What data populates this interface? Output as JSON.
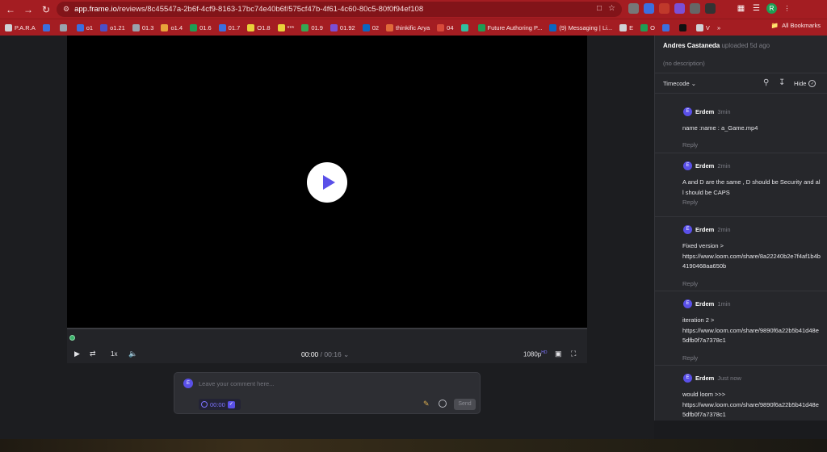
{
  "browser": {
    "url_host": "app.frame.io",
    "url_path": "/reviews/8c45547a-2b6f-4cf9-8163-17bc74e40b6f/575cf47b-4f61-4c60-80c5-80f0f94ef108",
    "profile_initial": "R"
  },
  "bookmarks": [
    {
      "label": "P.A.R.A",
      "color": "#cfd2d6"
    },
    {
      "label": "",
      "color": "#3b6fe0"
    },
    {
      "label": "",
      "color": "#9aa3ad"
    },
    {
      "label": "o1",
      "color": "#3b6fe0"
    },
    {
      "label": "o1.21",
      "color": "#4b4fc7"
    },
    {
      "label": "01.3",
      "color": "#9aa3ad"
    },
    {
      "label": "o1.4",
      "color": "#e8a33a"
    },
    {
      "label": "01.6",
      "color": "#1e9e54"
    },
    {
      "label": "01.7",
      "color": "#3b6fe0"
    },
    {
      "label": "O1.8",
      "color": "#e8d23a"
    },
    {
      "label": "***",
      "color": "#e8d23a"
    },
    {
      "label": "01.9",
      "color": "#34a853"
    },
    {
      "label": "01.92",
      "color": "#7b4fd6"
    },
    {
      "label": "02",
      "color": "#0a66c2"
    },
    {
      "label": "thinkific Arya",
      "color": "#e06a3a"
    },
    {
      "label": "04",
      "color": "#d84a3a"
    },
    {
      "label": "",
      "color": "#2fbfa0"
    },
    {
      "label": "Future Authoring P...",
      "color": "#1e9e54"
    },
    {
      "label": "(9) Messaging | Li...",
      "color": "#0a66c2"
    },
    {
      "label": "E",
      "color": "#cfd2d6"
    },
    {
      "label": "O",
      "color": "#1e9e54"
    },
    {
      "label": "",
      "color": "#3b6fe0"
    },
    {
      "label": "",
      "color": "#111"
    },
    {
      "label": "V",
      "color": "#cfd2d6"
    }
  ],
  "bookmarks_all": "All Bookmarks",
  "player": {
    "time_current": "00:00",
    "time_separator": "/",
    "time_duration": "00:16",
    "speed": "1x",
    "quality": "1080p",
    "quality_badge": "HD"
  },
  "composer": {
    "avatar_initial": "E",
    "placeholder": "Leave your comment here...",
    "timecode": "00:00",
    "send_label": "Send"
  },
  "sidebar": {
    "uploader_name": "Andres Castaneda",
    "uploader_action": "uploaded",
    "uploader_ago": "5d ago",
    "description": "(no description)",
    "timecode_menu": "Timecode",
    "hide_label": "Hide",
    "reply_label": "Reply",
    "comments": [
      {
        "initial": "E",
        "author": "Erdem",
        "time": "3min",
        "body": "name :name : a_Game.mp4"
      },
      {
        "initial": "E",
        "author": "Erdem",
        "time": "2min",
        "body": "A and D are the same , D should be Security and all should be CAPS"
      },
      {
        "initial": "E",
        "author": "Erdem",
        "time": "2min",
        "body": "Fixed version >\nhttps://www.loom.com/share/8a22240b2e7f4af1b4b4190468aa650b"
      },
      {
        "initial": "E",
        "author": "Erdem",
        "time": "1min",
        "body": "iteration 2 >\nhttps://www.loom.com/share/9890f6a22b5b41d48e5dfb0f7a7378c1"
      },
      {
        "initial": "E",
        "author": "Erdem",
        "time": "Just now",
        "body": "would loom >>>\nhttps://www.loom.com/share/9890f6a22b5b41d48e5dfb0f7a7378c1"
      }
    ]
  },
  "colors": {
    "browser_chrome": "#a41d22",
    "accent": "#5a50e8",
    "panel": "#26272b"
  }
}
